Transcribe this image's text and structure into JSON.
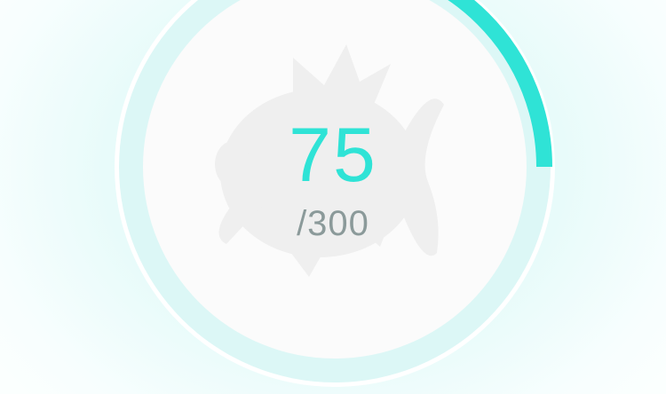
{
  "candy_meter": {
    "current": "75",
    "max": "/300",
    "progress_fraction": 0.25,
    "icon": "magikarp-silhouette-icon"
  },
  "colors": {
    "accent": "#2fe3d6",
    "ring_track": "#dcf7f6",
    "inner_disc": "#fbfbfb",
    "silhouette": "#efefef",
    "secondary_text": "#8b9a9a"
  }
}
